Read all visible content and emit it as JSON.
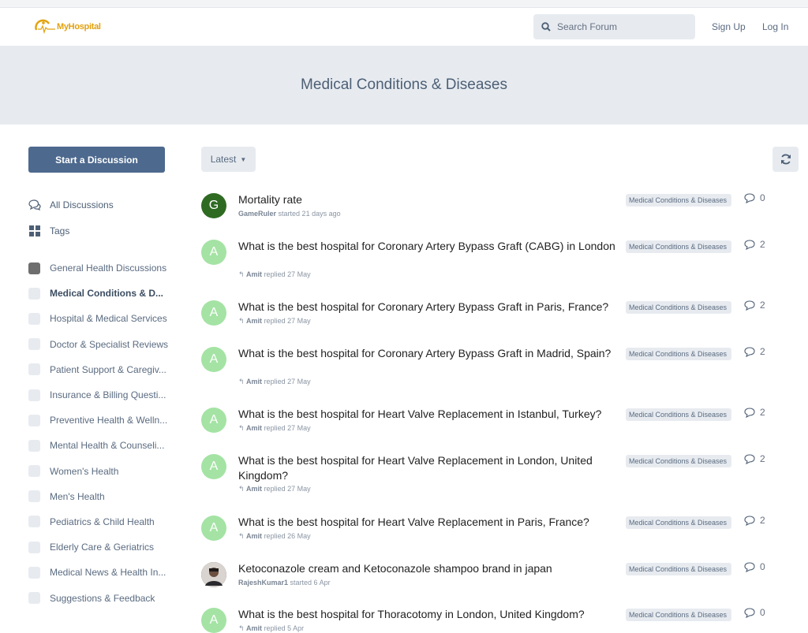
{
  "header": {
    "logo_text": "MyHospital",
    "search_placeholder": "Search Forum",
    "signup_label": "Sign Up",
    "login_label": "Log In"
  },
  "hero": {
    "title": "Medical Conditions & Diseases"
  },
  "sidebar": {
    "start_label": "Start a Discussion",
    "nav": [
      {
        "label": "All Discussions",
        "icon": "discussions-icon"
      },
      {
        "label": "Tags",
        "icon": "tags-grid-icon"
      }
    ],
    "tags": [
      {
        "label": "General Health Discussions"
      },
      {
        "label": "Medical Conditions & D..."
      },
      {
        "label": "Hospital & Medical Services"
      },
      {
        "label": "Doctor & Specialist Reviews"
      },
      {
        "label": "Patient Support & Caregiv..."
      },
      {
        "label": "Insurance & Billing Questi..."
      },
      {
        "label": "Preventive Health & Welln..."
      },
      {
        "label": "Mental Health & Counseli..."
      },
      {
        "label": "Women's Health"
      },
      {
        "label": "Men's Health"
      },
      {
        "label": "Pediatrics & Child Health"
      },
      {
        "label": "Elderly Care & Geriatrics"
      },
      {
        "label": "Medical News & Health In..."
      },
      {
        "label": "Suggestions & Feedback"
      }
    ]
  },
  "toolbar": {
    "sort_label": "Latest"
  },
  "discussions": [
    {
      "avatar": "G",
      "avatar_color": "#2f6a23",
      "title": "Mortality rate",
      "author": "GameRuler",
      "action": "started 21 days ago",
      "reply_icon": false,
      "tag": "Medical Conditions & Diseases",
      "count": "0"
    },
    {
      "avatar": "A",
      "avatar_color": "#a4e3a4",
      "title": "What is the best hospital for Coronary Artery Bypass Graft (CABG) in London",
      "author": "Amit",
      "action": "replied 27 May",
      "reply_icon": true,
      "tag": "Medical Conditions & Diseases",
      "count": "2"
    },
    {
      "avatar": "A",
      "avatar_color": "#a4e3a4",
      "title": "What is the best hospital for Coronary Artery Bypass Graft in Paris, France?",
      "author": "Amit",
      "action": "replied 27 May",
      "reply_icon": true,
      "tag": "Medical Conditions & Diseases",
      "count": "2"
    },
    {
      "avatar": "A",
      "avatar_color": "#a4e3a4",
      "title": "What is the best hospital for Coronary Artery Bypass Graft in Madrid, Spain?",
      "author": "Amit",
      "action": "replied 27 May",
      "reply_icon": true,
      "tag": "Medical Conditions & Diseases",
      "count": "2"
    },
    {
      "avatar": "A",
      "avatar_color": "#a4e3a4",
      "title": "What is the best hospital for Heart Valve Replacement in Istanbul, Turkey?",
      "author": "Amit",
      "action": "replied 27 May",
      "reply_icon": true,
      "tag": "Medical Conditions & Diseases",
      "count": "2"
    },
    {
      "avatar": "A",
      "avatar_color": "#a4e3a4",
      "title": "What is the best hospital for Heart Valve Replacement in London, United Kingdom?",
      "author": "Amit",
      "action": "replied 27 May",
      "reply_icon": true,
      "tag": "Medical Conditions & Diseases",
      "count": "2"
    },
    {
      "avatar": "A",
      "avatar_color": "#a4e3a4",
      "title": "What is the best hospital for Heart Valve Replacement in Paris, France?",
      "author": "Amit",
      "action": "replied 26 May",
      "reply_icon": true,
      "tag": "Medical Conditions & Diseases",
      "count": "2"
    },
    {
      "avatar": "",
      "avatar_color": "#3a3330",
      "title": "Ketoconazole cream and Ketoconazole shampoo brand in japan",
      "author": "RajeshKumar1",
      "action": "started 6 Apr",
      "reply_icon": false,
      "tag": "Medical Conditions & Diseases",
      "count": "0"
    },
    {
      "avatar": "A",
      "avatar_color": "#a4e3a4",
      "title": "What is the best hospital for Thoracotomy in London, United Kingdom?",
      "author": "Amit",
      "action": "replied 5 Apr",
      "reply_icon": true,
      "tag": "Medical Conditions & Diseases",
      "count": "0"
    }
  ],
  "colors": {
    "accent": "#4d698e",
    "panel": "#e7ebf0",
    "logo": "#e3a210"
  }
}
